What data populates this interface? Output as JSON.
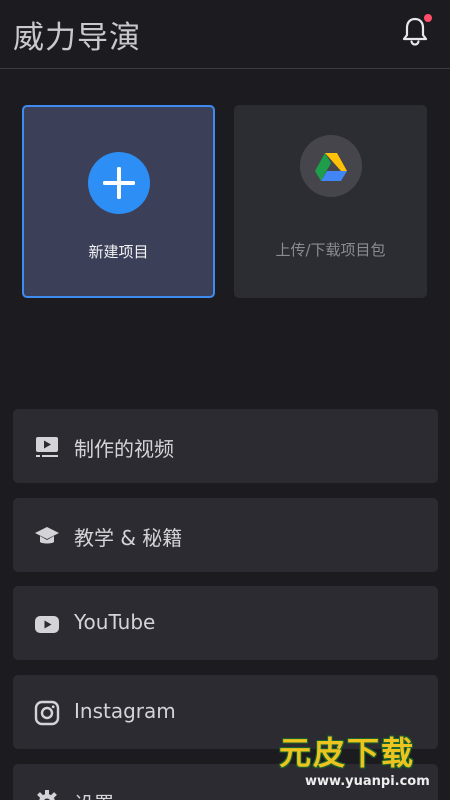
{
  "header": {
    "title": "威力导演"
  },
  "cards": {
    "new_project": {
      "label": "新建项目"
    },
    "upload": {
      "label": "上传/下载项目包"
    }
  },
  "menu": [
    {
      "label": "制作的视频",
      "icon": "video-library-icon"
    },
    {
      "label": "教学 & 秘籍",
      "icon": "graduation-cap-icon"
    },
    {
      "label": "YouTube",
      "icon": "youtube-icon"
    },
    {
      "label": "Instagram",
      "icon": "instagram-icon"
    },
    {
      "label": "设置",
      "icon": "gear-icon"
    }
  ],
  "watermark": {
    "text": "元皮下载",
    "url": "www.yuanpi.com"
  },
  "colors": {
    "accent": "#2d8ff5",
    "notification": "#ff4d6a",
    "background": "#1c1c20"
  }
}
